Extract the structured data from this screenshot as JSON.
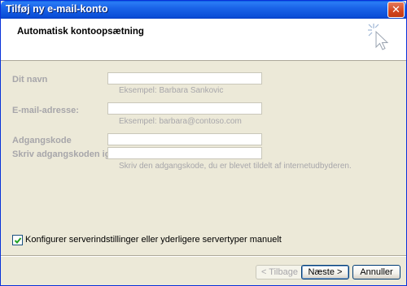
{
  "window": {
    "title": "Tilføj ny e-mail-konto",
    "close_glyph": "✕"
  },
  "header": {
    "title": "Automatisk kontoopsætning",
    "icon": "wizard-cursor-icon"
  },
  "form": {
    "name_label": "Dit navn",
    "name_value": "",
    "name_hint": "Eksempel: Barbara Sankovic",
    "email_label": "E-mail-adresse:",
    "email_value": "",
    "email_hint": "Eksempel: barbara@contoso.com",
    "password_label": "Adgangskode",
    "password_value": "",
    "password_repeat_label": "Skriv adgangskoden igen:",
    "password_repeat_value": "",
    "password_hint": "Skriv den adgangskode, du er blevet tildelt af internetudbyderen."
  },
  "manual_config": {
    "label": "Konfigurer serverindstillinger eller yderligere servertyper manuelt",
    "checked": true
  },
  "buttons": {
    "back": "< Tilbage",
    "next": "Næste >",
    "cancel": "Annuller"
  },
  "colors": {
    "titlebar": "#0a5ce0",
    "disabled_text": "#a7a6aa",
    "face": "#ece9d8"
  }
}
